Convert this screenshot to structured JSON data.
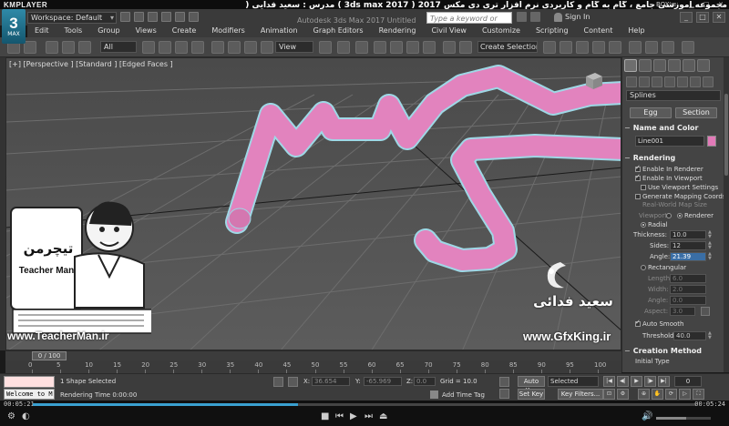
{
  "player": {
    "logo": "KMPLAYER",
    "window_tag": "BOX ≡",
    "time_current": "00:05:21",
    "time_total": "00:05:24",
    "progress": 0.4,
    "volume": 0.55
  },
  "app": {
    "logo_number": "3",
    "logo_text": "MAX",
    "workspace": "Workspace: Default",
    "course_title": "مجموعه آموزشی جامع ، گام به گام و کاربردی نرم افزار تری دی مکس 2017  ( 3ds max 2017 )   مدرس : سعید فدایی ( تیچرمن ) گروه آموزشی پادشاه گرافیست ها",
    "document_title": "Autodesk 3ds Max 2017    Untitled",
    "search_placeholder": "Type a keyword or phrase",
    "sign_in": "Sign In"
  },
  "menu": [
    "Edit",
    "Tools",
    "Group",
    "Views",
    "Create",
    "Modifiers",
    "Animation",
    "Graph Editors",
    "Rendering",
    "Civil View",
    "Customize",
    "Scripting",
    "Content",
    "Help"
  ],
  "toolbar": {
    "filter": "All",
    "reference_coord": "View",
    "selection_set": "Create Selection Se"
  },
  "viewport": {
    "label": "[+] [Perspective ] [Standard ] [Edged Faces ]"
  },
  "watermarks": {
    "teacher_logo_text": "تیچرمن",
    "teacher_tagline": "Teacher Man",
    "teacher_url": "www.TeacherMan.ir",
    "gfx_name": "سعید فدائی",
    "gfx_url": "www.GfxKing.ir"
  },
  "command_panel": {
    "category": "Splines",
    "buttons": [
      "Egg",
      "Section"
    ],
    "name_color_title": "Name and Color",
    "object_name": "Line001",
    "object_color": "#e27ab8",
    "rendering_title": "Rendering",
    "enable_in_renderer": "Enable In Renderer",
    "enable_in_viewport": "Enable In Viewport",
    "use_viewport_settings": "Use Viewport Settings",
    "generate_mapping": "Generate Mapping Coords.",
    "real_world_map": "Real-World Map Size",
    "viewport_opt": "Viewport",
    "renderer_opt": "Renderer",
    "radial": "Radial",
    "thickness_label": "Thickness:",
    "thickness": "10.0",
    "sides_label": "Sides:",
    "sides": "12",
    "angle_label": "Angle:",
    "angle": "21.39",
    "rectangular": "Rectangular",
    "length_label": "Length:",
    "length": "6.0",
    "width_label": "Width:",
    "width": "2.0",
    "rect_angle_label": "Angle:",
    "rect_angle": "0.0",
    "aspect_label": "Aspect:",
    "aspect": "3.0",
    "auto_smooth": "Auto Smooth",
    "threshold_label": "Threshold:",
    "threshold": "40.0",
    "creation_method_title": "Creation Method",
    "initial_type": "Initial Type"
  },
  "timeline": {
    "slider_label": "0 / 100",
    "ticks": [
      "0",
      "5",
      "10",
      "15",
      "20",
      "25",
      "30",
      "35",
      "40",
      "45",
      "50",
      "55",
      "60",
      "65",
      "70",
      "75",
      "80",
      "85",
      "90",
      "95",
      "100"
    ]
  },
  "status": {
    "maxscript_listener": "Welcome to M",
    "selection": "1 Shape Selected",
    "render_time": "Rendering Time  0:00:00",
    "x_label": "X:",
    "x_value": "36.654",
    "y_label": "Y:",
    "y_value": "-65.969",
    "z_label": "Z:",
    "z_value": "0.0",
    "grid": "Grid = 10.0",
    "add_time_tag": "Add Time Tag",
    "auto_key": "Auto Key",
    "selected": "Selected",
    "set_key": "Set Key",
    "key_filters": "Key Filters...",
    "current_frame": "0"
  }
}
